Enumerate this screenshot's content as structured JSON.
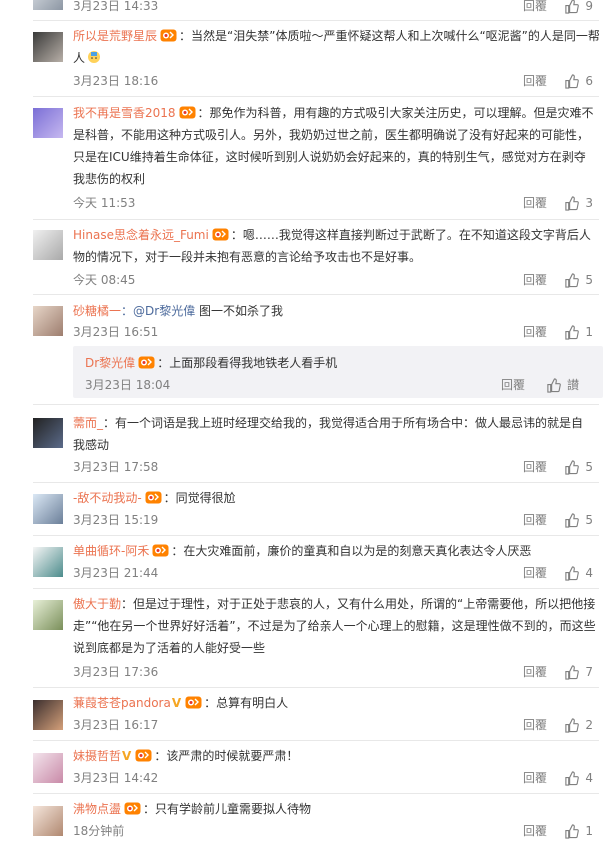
{
  "comments": [
    {
      "user": "",
      "text": "",
      "time": "3月23日 14:33",
      "reply": "回覆",
      "likes": "9"
    },
    {
      "user": "所以是荒野星辰",
      "text_1": "：当然是“泪失禁”体质啦～严重怀疑这帮人和上次喊什么“呕泥酱”的人是同一帮",
      "text_2": "人",
      "time": "3月23日 18:16",
      "reply": "回覆",
      "likes": "6"
    },
    {
      "user": "我不再是雪香2018",
      "text_1": "：那免作为科普，用有趣的方式吸引大家关注历史，可以理解。但是灾难不",
      "text_2": "是科普，不能用这种方式吸引人。另外，我奶奶过世之前，医生都明确说了没有好起来的可能性，",
      "text_3": "只是在ICU维持着生命体征，这时候听到别人说奶奶会好起来的，真的特别生气，感觉对方在剥夺",
      "text_4": "我悲伤的权利",
      "time": "今天 11:53",
      "reply": "回覆",
      "likes": "3"
    },
    {
      "user": "Hinase思念着永远_Fumi",
      "text_1": "：嗯……我觉得这样直接判断过于武断了。在不知道这段文字背后人",
      "text_2": "物的情况下，对于一段并未抱有恶意的言论给予攻击也不是好事。",
      "time": "今天 08:45",
      "reply": "回覆",
      "likes": "5"
    },
    {
      "user": "砂糖橘一",
      "mention": "：@Dr黎光偉",
      "text_1": " 图一不如杀了我",
      "time": "3月23日 16:51",
      "reply": "回覆",
      "likes": "1",
      "nested": {
        "user": "Dr黎光偉",
        "text": "：上面那段看得我地铁老人看手机",
        "time": "3月23日 18:04",
        "reply": "回覆",
        "likes": "讃"
      }
    },
    {
      "user": "薷而_",
      "text_1": "：有一个词语是我上班时经理交给我的，我觉得适合用于所有场合中：做人最忌讳的就是自",
      "text_2": "我感动",
      "time": "3月23日 17:58",
      "reply": "回覆",
      "likes": "5"
    },
    {
      "user": "-敌不动我动-",
      "text_1": "：同觉得很尬",
      "time": "3月23日 15:19",
      "reply": "回覆",
      "likes": "5"
    },
    {
      "user": "单曲循环-阿禾",
      "text_1": "：在大灾难面前，廉价的童真和自以为是的刻意天真化表达令人厌恶",
      "time": "3月23日 21:44",
      "reply": "回覆",
      "likes": "4"
    },
    {
      "user": "傲大于勤",
      "text_1": "：但是过于理性，对于正处于悲哀的人，又有什么用处，所谓的“上帝需要他，所以把他接",
      "text_2": "走”“他在另一个世界好好活着”，不过是为了给亲人一个心理上的慰籍，这是理性做不到的，而这些",
      "text_3": "说到底都是为了活着的人能好受一些",
      "time": "3月23日 17:36",
      "reply": "回覆",
      "likes": "7"
    },
    {
      "user": "蒹葭苍苍pandora",
      "text_1": "：总算有明白人",
      "time": "3月23日 16:17",
      "reply": "回覆",
      "likes": "2"
    },
    {
      "user": "妹摄哲哲",
      "text_1": "：该严肃的时候就要严肃！",
      "time": "3月23日 14:42",
      "reply": "回覆",
      "likes": "4"
    },
    {
      "user": "沸物点盪",
      "text_1": "：只有学龄前儿童需要拟人待物",
      "time": "18分钟前",
      "reply": "回覆",
      "likes": "1"
    }
  ],
  "colors": {
    "username": "#eb7350",
    "nested_username": "#eb7350",
    "mention": "#4c6a9c",
    "meta": "#808080",
    "separator": "#e8e8e8",
    "nested_bg": "#f2f2f5",
    "vip_badge": "#f5a623"
  },
  "icons": {
    "like": "thumb-up-icon",
    "member_badge": "weibo-member-badge-icon",
    "verified": "v-badge-icon",
    "emoji": "emoji-icon"
  }
}
